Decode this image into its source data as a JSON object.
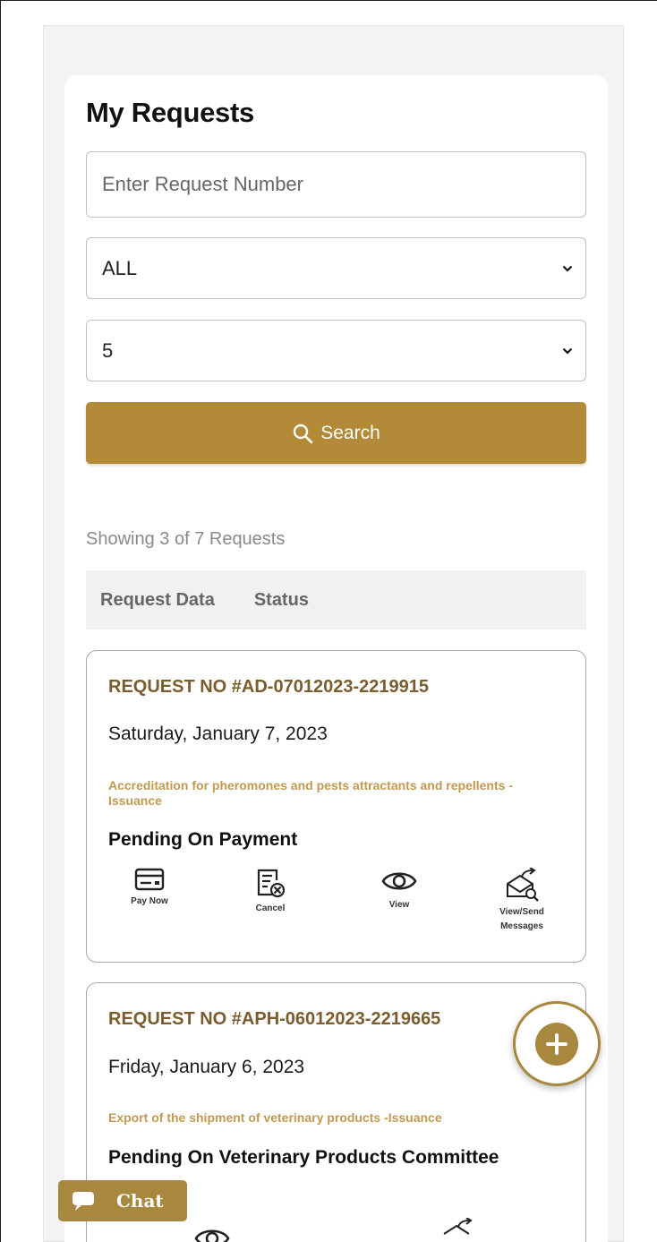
{
  "page": {
    "title": "My Requests"
  },
  "search": {
    "request_number_placeholder": "Enter Request Number",
    "status_filter_value": "ALL",
    "page_size_value": "5",
    "search_button_label": "Search"
  },
  "results": {
    "showing_text": "Showing 3 of 7 Requests",
    "columns": [
      "Request Data",
      "Status"
    ]
  },
  "requests": [
    {
      "number": "REQUEST NO #AD-07012023-2219915",
      "date": "Saturday, January 7, 2023",
      "service": "Accreditation for pheromones and pests attractants and repellents -Issuance",
      "status": "Pending On Payment",
      "actions": [
        {
          "label": "Pay Now",
          "icon": "credit-card-icon"
        },
        {
          "label": "Cancel",
          "icon": "cancel-document-icon"
        },
        {
          "label": "View",
          "icon": "eye-icon"
        },
        {
          "label": "View/Send Messages",
          "icon": "messages-icon"
        }
      ]
    },
    {
      "number": "REQUEST NO #APH-06012023-2219665",
      "date": "Friday, January 6, 2023",
      "service": "Export of the shipment of veterinary products -Issuance",
      "status": "Pending On Veterinary Products Committee"
    }
  ],
  "chat": {
    "label": "Chat"
  },
  "colors": {
    "accent": "#b38a38",
    "request_no": "#7a5d2e",
    "service_text": "#c19a52"
  }
}
